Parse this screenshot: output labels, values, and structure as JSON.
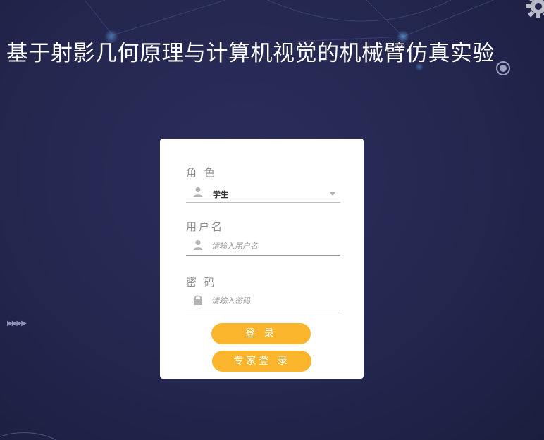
{
  "app": {
    "title": "基于射影几何原理与计算机视觉的机械臂仿真实验"
  },
  "decor": {
    "arrows": "▶▶▶▶",
    "gear_icon": "gear-icon",
    "background_color": "#262952"
  },
  "login": {
    "role": {
      "label": "角 色",
      "value": "学生",
      "icon": "user-icon"
    },
    "username": {
      "label": "用户名",
      "placeholder": "请输入用户名",
      "value": "",
      "icon": "user-icon"
    },
    "password": {
      "label": "密 码",
      "placeholder": "请输入密码",
      "value": "",
      "icon": "lock-icon"
    },
    "login_button": "登 录",
    "expert_login_button": "专家登 录",
    "accent_color": "#fbb52c"
  }
}
